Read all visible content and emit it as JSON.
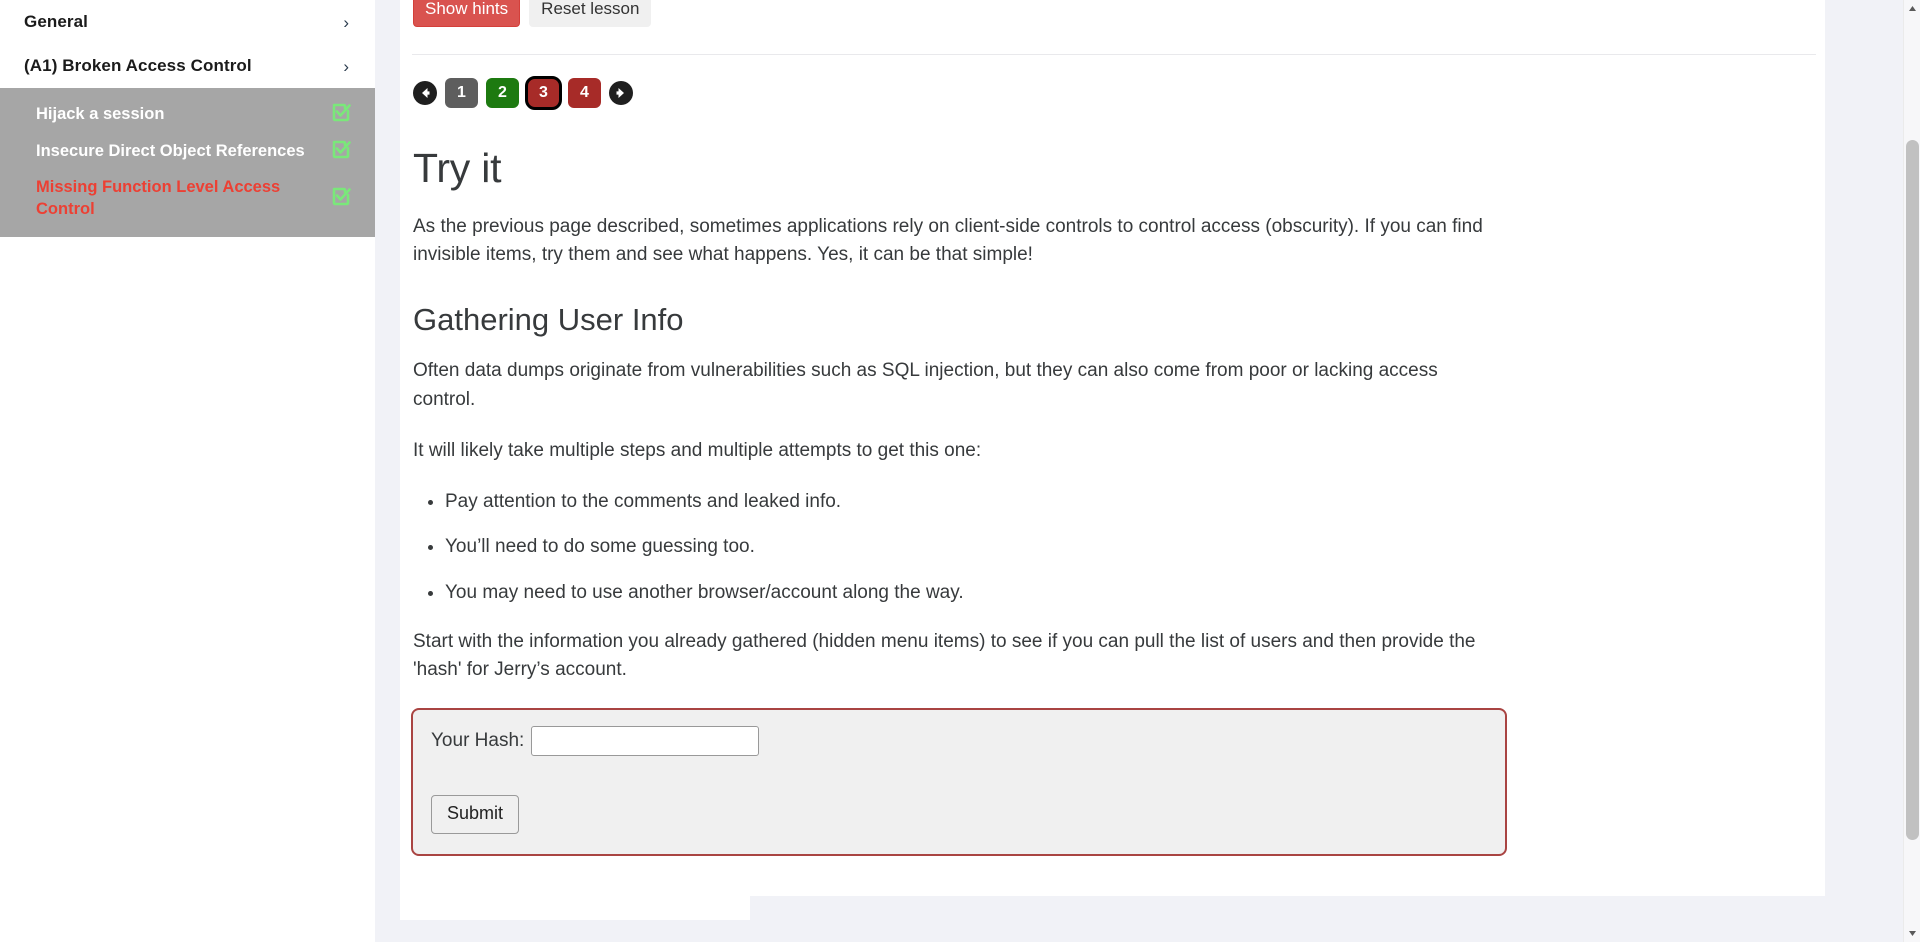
{
  "sidebar": {
    "groups": [
      {
        "label": "General",
        "icon": "chevron-right-icon",
        "expanded": false
      },
      {
        "label": "(A1) Broken Access Control",
        "icon": "chevron-right-icon",
        "expanded": true
      }
    ],
    "lessons": [
      {
        "label": "Hijack a session",
        "status_icon": "check-square-icon",
        "active": false
      },
      {
        "label": "Insecure Direct Object References",
        "status_icon": "check-square-icon",
        "active": false
      },
      {
        "label": "Missing Function Level Access Control",
        "status_icon": "check-square-icon",
        "active": true
      }
    ],
    "colors": {
      "sublist_background": "#a6a6a6",
      "active_label": "#ec4034",
      "check_icon": "#7ae87a"
    }
  },
  "toolbar": {
    "show_hints_label": "Show hints",
    "reset_lesson_label": "Reset lesson",
    "hints_color": "#d9534f"
  },
  "pagination": {
    "prev_icon": "arrow-left-circle-icon",
    "next_icon": "arrow-right-circle-icon",
    "current": "3",
    "pages": [
      {
        "label": "1",
        "state": "plain",
        "current": false
      },
      {
        "label": "2",
        "state": "solved",
        "current": false
      },
      {
        "label": "3",
        "state": "fail",
        "current": true
      },
      {
        "label": "4",
        "state": "fail",
        "current": false
      }
    ],
    "colors": {
      "plain": "#5e5e5e",
      "solved": "#1d7a10",
      "fail": "#a72b28",
      "current_outline": "#000000"
    }
  },
  "lesson": {
    "title": "Try it",
    "intro": "As the previous page described, sometimes applications rely on client-side controls to control access (obscurity). If you can find invisible items, try them and see what happens. Yes, it can be that simple!",
    "section_heading": "Gathering User Info",
    "paragraph_1": "Often data dumps originate from vulnerabilities such as SQL injection, but they can also come from poor or lacking access control.",
    "paragraph_2": "It will likely take multiple steps and multiple attempts to get this one:",
    "tips": [
      "Pay attention to the comments and leaked info.",
      "You’ll need to do some guessing too.",
      "You may need to use another browser/account along the way."
    ],
    "paragraph_3": "Start with the information you already gathered (hidden menu items) to see if you can pull the list of users and then provide the 'hash' for Jerry’s account."
  },
  "form": {
    "hash_label": "Your Hash:",
    "hash_value": "",
    "hash_placeholder": "",
    "submit_label": "Submit",
    "border_color": "#a94442"
  },
  "scrollbar": {
    "up_icon": "scroll-up-arrow-icon",
    "down_icon": "scroll-down-arrow-icon",
    "thumb_color": "#c1c1c1"
  }
}
